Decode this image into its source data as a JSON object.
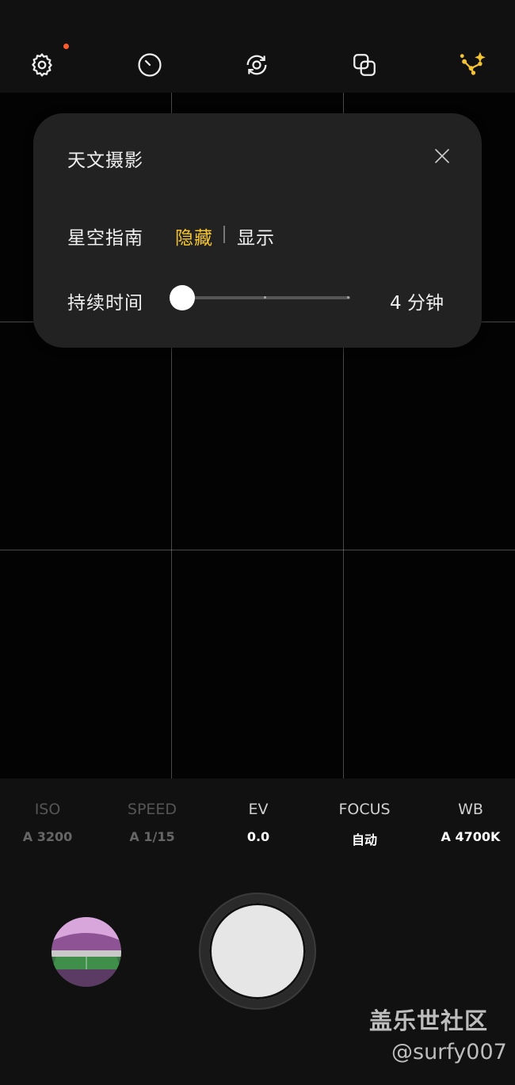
{
  "top_bar": {
    "icons": [
      "gear-icon",
      "timer-icon",
      "camera-switch-icon",
      "overlap-icon",
      "stars-icon"
    ],
    "settings_has_notification": true,
    "accent_color": "#f4c431",
    "notification_color": "#ff5a2e"
  },
  "astro_panel": {
    "title": "天文摄影",
    "star_guide": {
      "label": "星空指南",
      "options": [
        "隐藏",
        "显示"
      ],
      "selected": "隐藏"
    },
    "duration": {
      "label": "持续时间",
      "value_text": "4 分钟",
      "slider_level": 0
    }
  },
  "pro_controls": [
    {
      "name": "ISO",
      "value": "A 3200",
      "enabled": false
    },
    {
      "name": "SPEED",
      "value": "A 1/15",
      "enabled": false
    },
    {
      "name": "EV",
      "value": "0.0",
      "enabled": true
    },
    {
      "name": "FOCUS",
      "value": "自动",
      "enabled": true
    },
    {
      "name": "WB",
      "value": "A 4700K",
      "enabled": true
    }
  ],
  "watermark": {
    "line1": "盖乐世社区",
    "line2": "@surfy007"
  }
}
